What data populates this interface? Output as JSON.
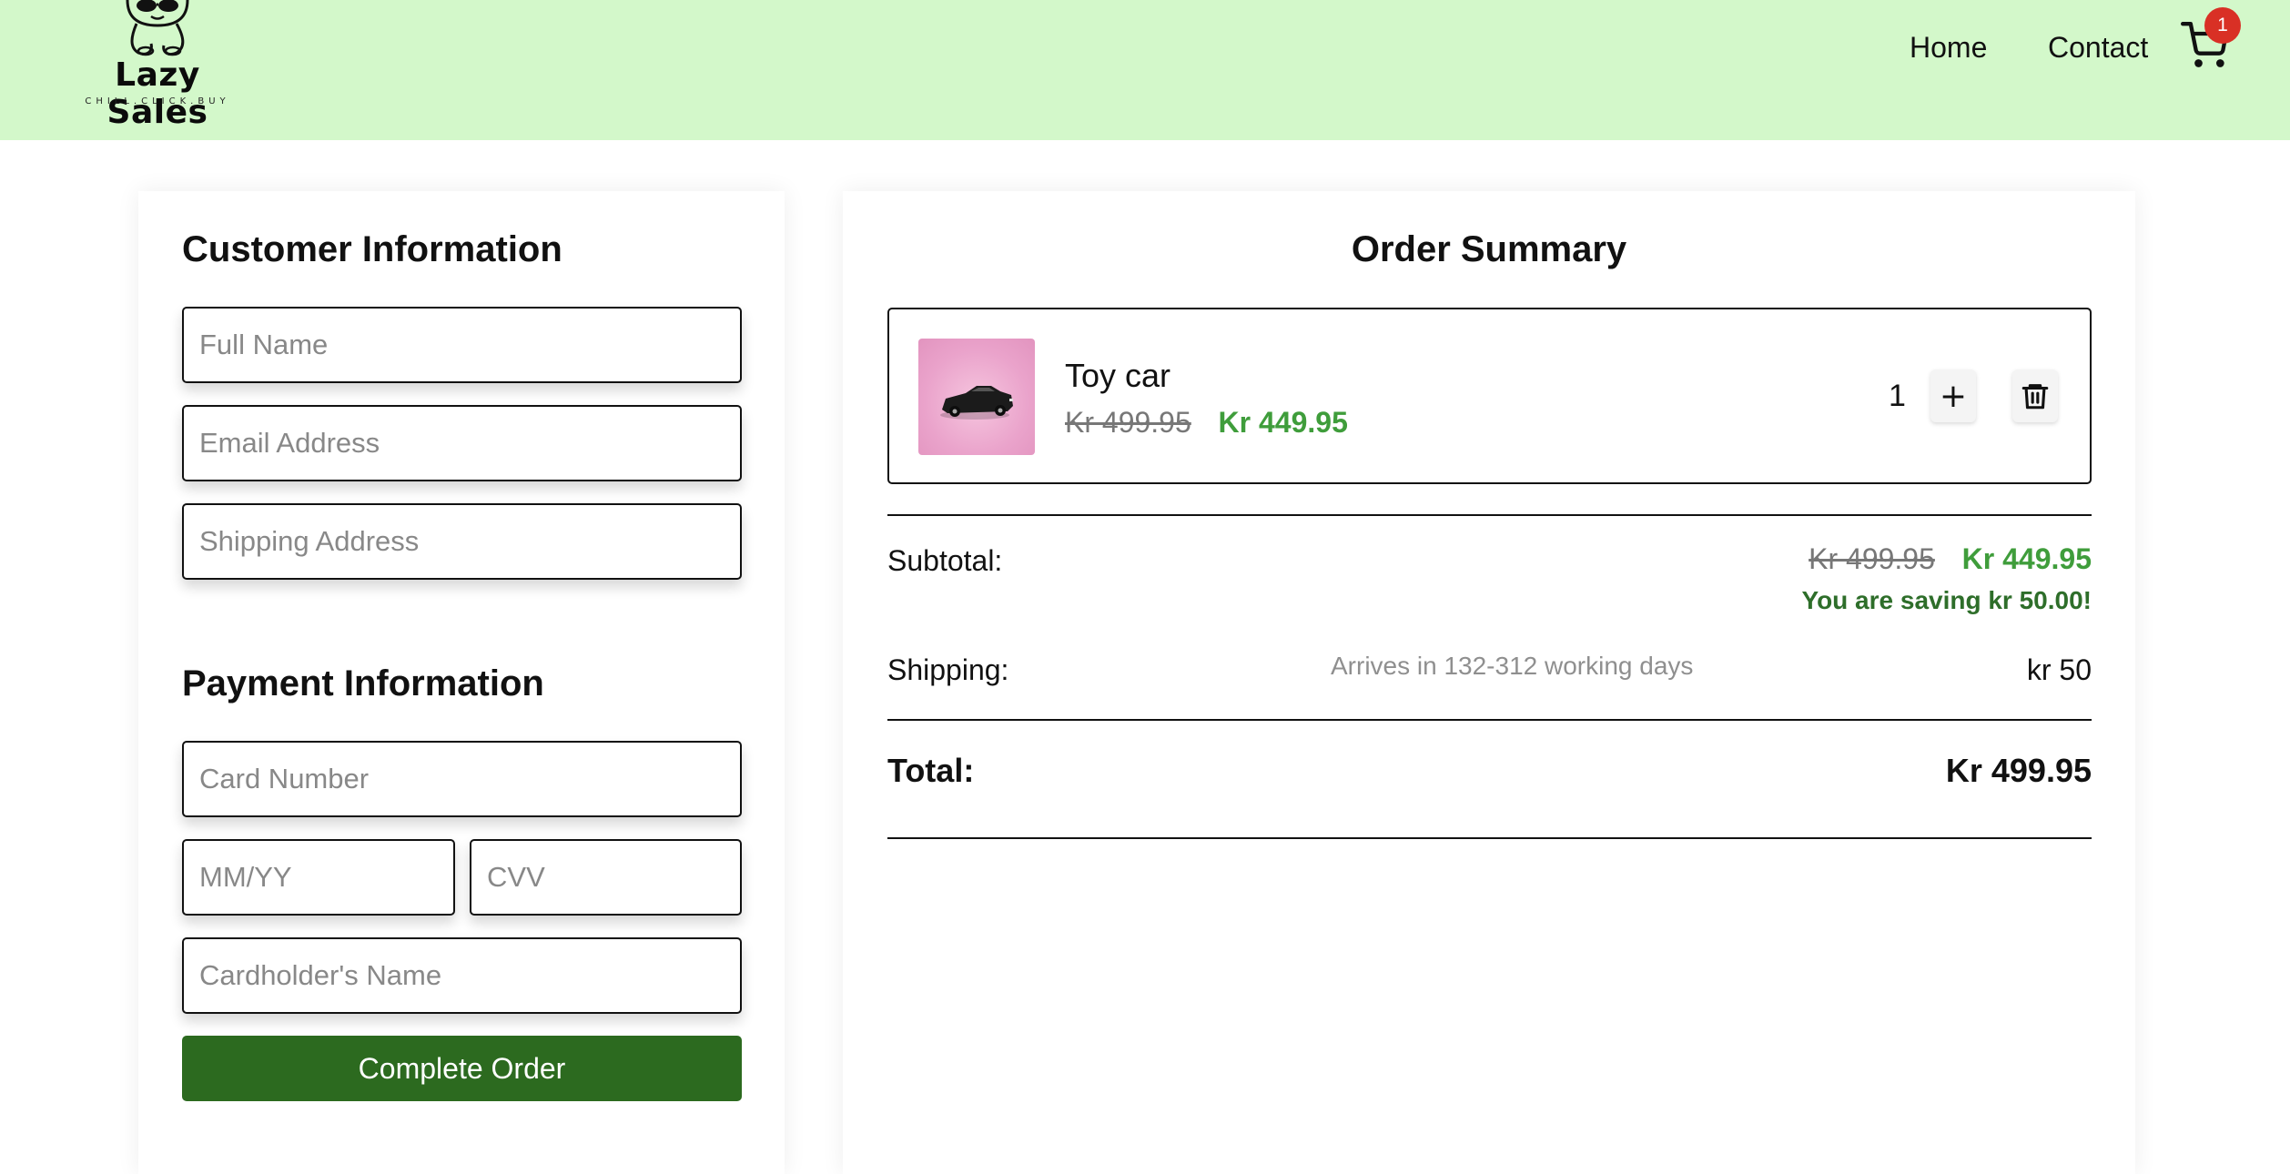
{
  "header": {
    "logo_title": "Lazy Sales",
    "logo_tagline": "CHILL.CLICK.BUY",
    "nav": {
      "home": "Home",
      "contact": "Contact"
    },
    "cart_count": "1",
    "bg_color": "#d3f8ca"
  },
  "customer": {
    "title": "Customer Information",
    "full_name_placeholder": "Full Name",
    "email_placeholder": "Email Address",
    "shipping_placeholder": "Shipping Address"
  },
  "payment": {
    "title": "Payment Information",
    "card_number_placeholder": "Card Number",
    "expiry_placeholder": "MM/YY",
    "cvv_placeholder": "CVV",
    "cardholder_placeholder": "Cardholder's Name",
    "submit_label": "Complete Order",
    "submit_color": "#2c6a1f"
  },
  "order": {
    "title": "Order Summary",
    "items": [
      {
        "name": "Toy car",
        "old_price": "Kr 499.95",
        "new_price": "Kr 449.95",
        "quantity": "1",
        "plus_label": "+"
      }
    ],
    "subtotal_label": "Subtotal:",
    "subtotal_old": "Kr 499.95",
    "subtotal_new": "Kr 449.95",
    "saving_text": "You are saving kr 50.00!",
    "shipping_label": "Shipping:",
    "shipping_note": "Arrives in 132-312 working days",
    "shipping_cost": "kr 50",
    "total_label": "Total:",
    "total_value": "Kr 499.95",
    "accent_green": "#3f9d3b"
  }
}
